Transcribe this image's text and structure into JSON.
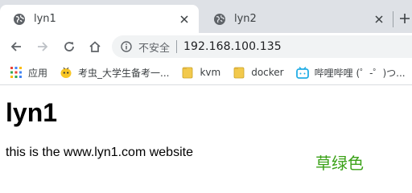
{
  "browser": {
    "tabs": [
      {
        "title": "lyn1",
        "active": true,
        "favicon": "globe-icon"
      },
      {
        "title": "lyn2",
        "active": false,
        "favicon": "globe-icon"
      }
    ],
    "address_bar": {
      "security_label": "不安全",
      "url": "192.168.100.135"
    },
    "bookmarks": [
      {
        "label": "应用",
        "icon": "apps-grid-icon"
      },
      {
        "label": "考虫_大学生备考一...",
        "icon": "bee-icon"
      },
      {
        "label": "kvm",
        "icon": "folder-icon"
      },
      {
        "label": "docker",
        "icon": "folder-icon"
      },
      {
        "label": "哔哩哔哩 (゜-゜)つ...",
        "icon": "bilibili-icon"
      }
    ]
  },
  "page": {
    "heading": "lyn1",
    "body_text": "this is the www.lyn1.com website",
    "annotation": "草绿色"
  },
  "colors": {
    "tabstrip_bg": "#dee1e6",
    "omnibox_bg": "#f1f3f4",
    "annotation_green": "#3ba218",
    "bookmark_folder": "#f2c94c"
  }
}
